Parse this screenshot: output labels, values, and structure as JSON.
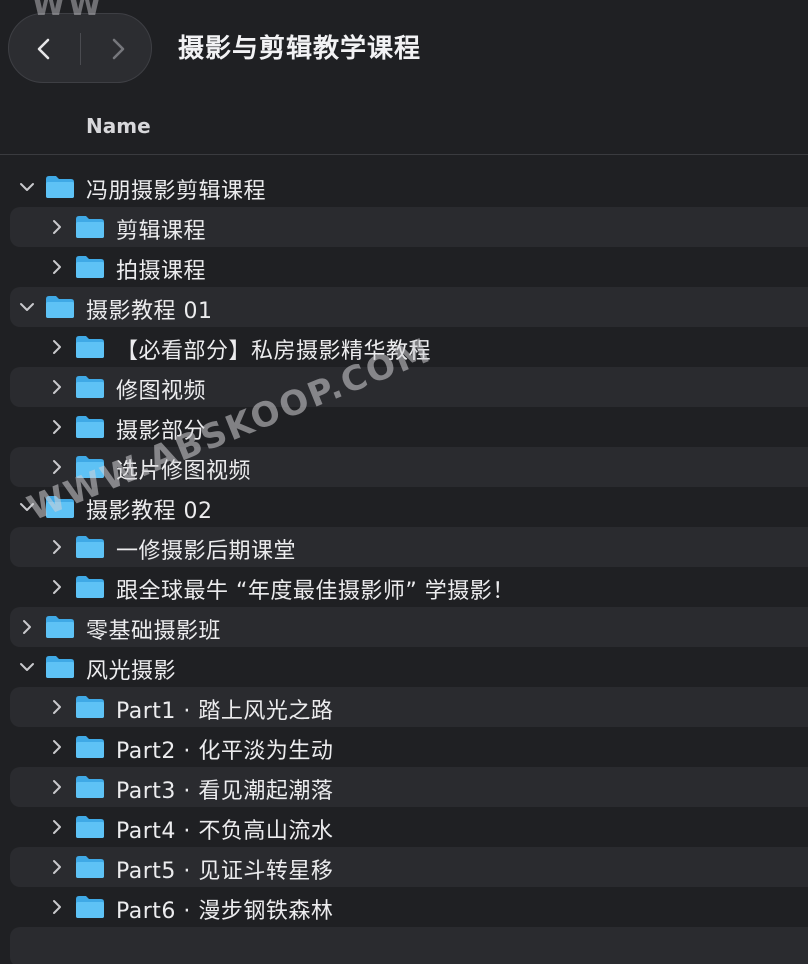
{
  "window": {
    "title": "摄影与剪辑教学课程"
  },
  "toolbar": {
    "back_icon": "chevron-left-icon",
    "forward_icon": "chevron-right-icon"
  },
  "columns": {
    "name_header": "Name"
  },
  "colors": {
    "background": "#1f2023",
    "folder": "#5ec2f5",
    "stripe": "#2a2b2f"
  },
  "rows": [
    {
      "label": "冯朋摄影剪辑课程",
      "depth": 0,
      "expanded": true
    },
    {
      "label": "剪辑课程",
      "depth": 1,
      "expanded": false
    },
    {
      "label": "拍摄课程",
      "depth": 1,
      "expanded": false
    },
    {
      "label": "摄影教程 01",
      "depth": 0,
      "expanded": true
    },
    {
      "label": "【必看部分】私房摄影精华教程",
      "depth": 1,
      "expanded": false
    },
    {
      "label": "修图视频",
      "depth": 1,
      "expanded": false
    },
    {
      "label": "摄影部分",
      "depth": 1,
      "expanded": false
    },
    {
      "label": "选片修图视频",
      "depth": 1,
      "expanded": false
    },
    {
      "label": "摄影教程 02",
      "depth": 0,
      "expanded": true
    },
    {
      "label": "一修摄影后期课堂",
      "depth": 1,
      "expanded": false
    },
    {
      "label": "跟全球最牛 “年度最佳摄影师” 学摄影！",
      "depth": 1,
      "expanded": false
    },
    {
      "label": "零基础摄影班",
      "depth": 0,
      "expanded": false
    },
    {
      "label": "风光摄影",
      "depth": 0,
      "expanded": true
    },
    {
      "label": "Part1 · 踏上风光之路",
      "depth": 1,
      "expanded": false
    },
    {
      "label": "Part2 · 化平淡为生动",
      "depth": 1,
      "expanded": false
    },
    {
      "label": "Part3 · 看见潮起潮落",
      "depth": 1,
      "expanded": false
    },
    {
      "label": "Part4 · 不负高山流水",
      "depth": 1,
      "expanded": false
    },
    {
      "label": "Part5 · 见证斗转星移",
      "depth": 1,
      "expanded": false
    },
    {
      "label": "Part6 · 漫步钢铁森林",
      "depth": 1,
      "expanded": false
    },
    {
      "label": "",
      "depth": 0,
      "expanded": false,
      "empty": true
    }
  ],
  "watermark": {
    "text": "WWW.ABSKOOP.COM",
    "top_text": "WW"
  }
}
